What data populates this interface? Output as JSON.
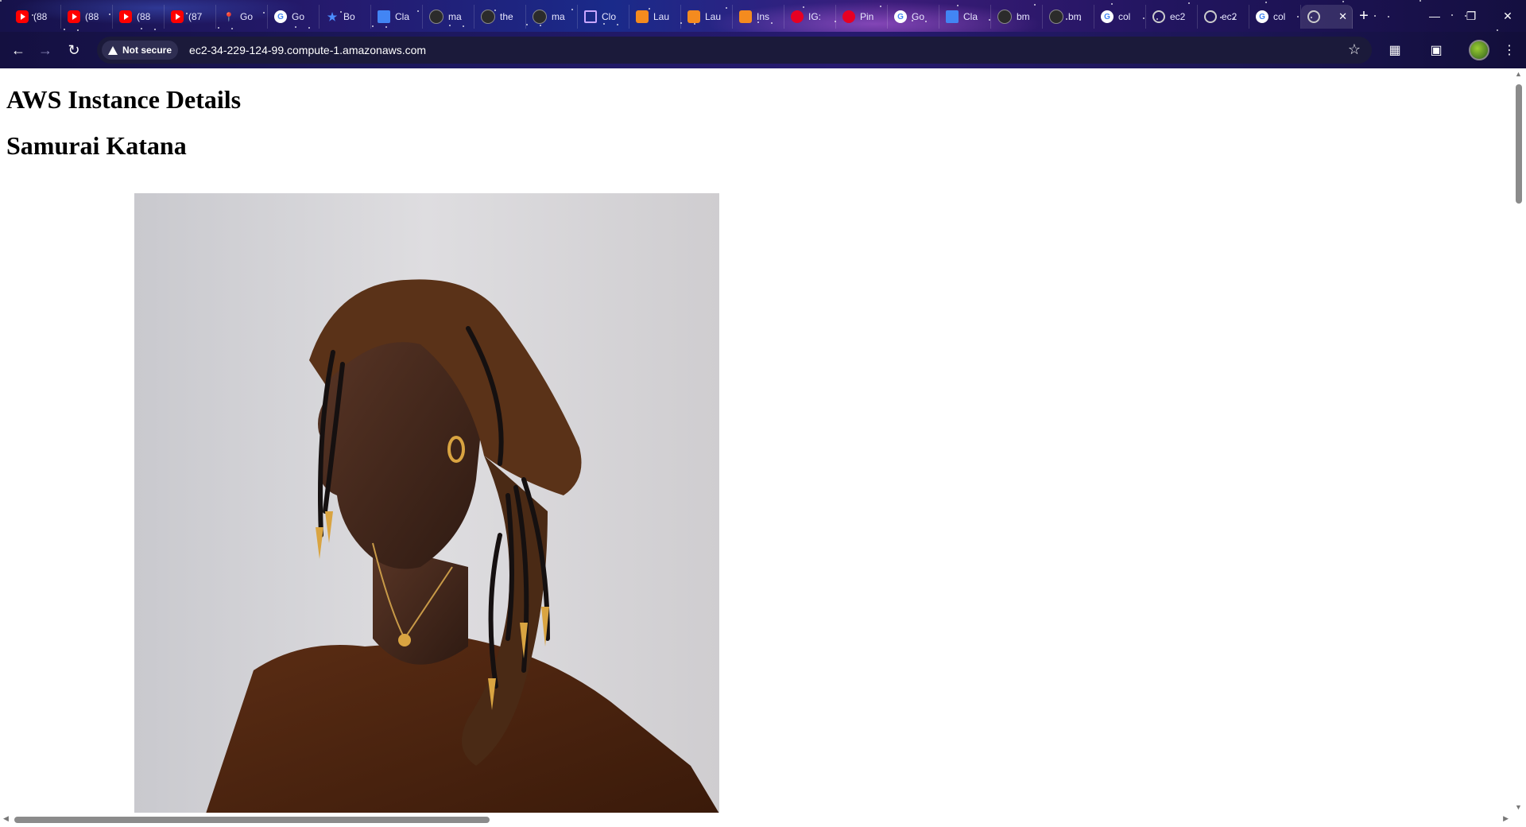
{
  "browser": {
    "tabs": [
      {
        "icon": "youtube-icon",
        "label": "(88"
      },
      {
        "icon": "youtube-icon",
        "label": "(88"
      },
      {
        "icon": "youtube-icon",
        "label": "(88"
      },
      {
        "icon": "youtube-icon",
        "label": "(87"
      },
      {
        "icon": "maps-icon",
        "label": "Go"
      },
      {
        "icon": "google-icon",
        "label": "Go"
      },
      {
        "icon": "bookmark-star-icon",
        "label": "Bo"
      },
      {
        "icon": "docs-icon",
        "label": "Cla"
      },
      {
        "icon": "github-icon",
        "label": "ma"
      },
      {
        "icon": "github-icon",
        "label": "the"
      },
      {
        "icon": "github-icon",
        "label": "ma"
      },
      {
        "icon": "cube-icon",
        "label": "Clo"
      },
      {
        "icon": "launch-icon",
        "label": "Lau"
      },
      {
        "icon": "launch-icon",
        "label": "Lau"
      },
      {
        "icon": "launch-icon",
        "label": "Ins"
      },
      {
        "icon": "pinterest-icon",
        "label": "IG:"
      },
      {
        "icon": "pinterest-icon",
        "label": "Pin"
      },
      {
        "icon": "google-icon",
        "label": "Go"
      },
      {
        "icon": "docs-icon",
        "label": "Cla"
      },
      {
        "icon": "github-icon",
        "label": "bm"
      },
      {
        "icon": "github-icon",
        "label": "bm"
      },
      {
        "icon": "google-icon",
        "label": "col"
      },
      {
        "icon": "globe-icon",
        "label": "ec2"
      },
      {
        "icon": "globe-icon",
        "label": "ec2"
      },
      {
        "icon": "google-icon",
        "label": "col"
      },
      {
        "icon": "globe-icon",
        "label": "",
        "active": true
      }
    ],
    "new_tab_symbol": "+",
    "window_controls": {
      "minimize": "—",
      "restore": "❐",
      "close": "✕"
    },
    "security_label": "Not secure",
    "url": "ec2-34-229-124-99.compute-1.amazonaws.com"
  },
  "page": {
    "heading": "AWS Instance Details",
    "subheading": "Samurai Katana",
    "image_alt": "Portrait of a woman with locs and brown headscarf"
  }
}
